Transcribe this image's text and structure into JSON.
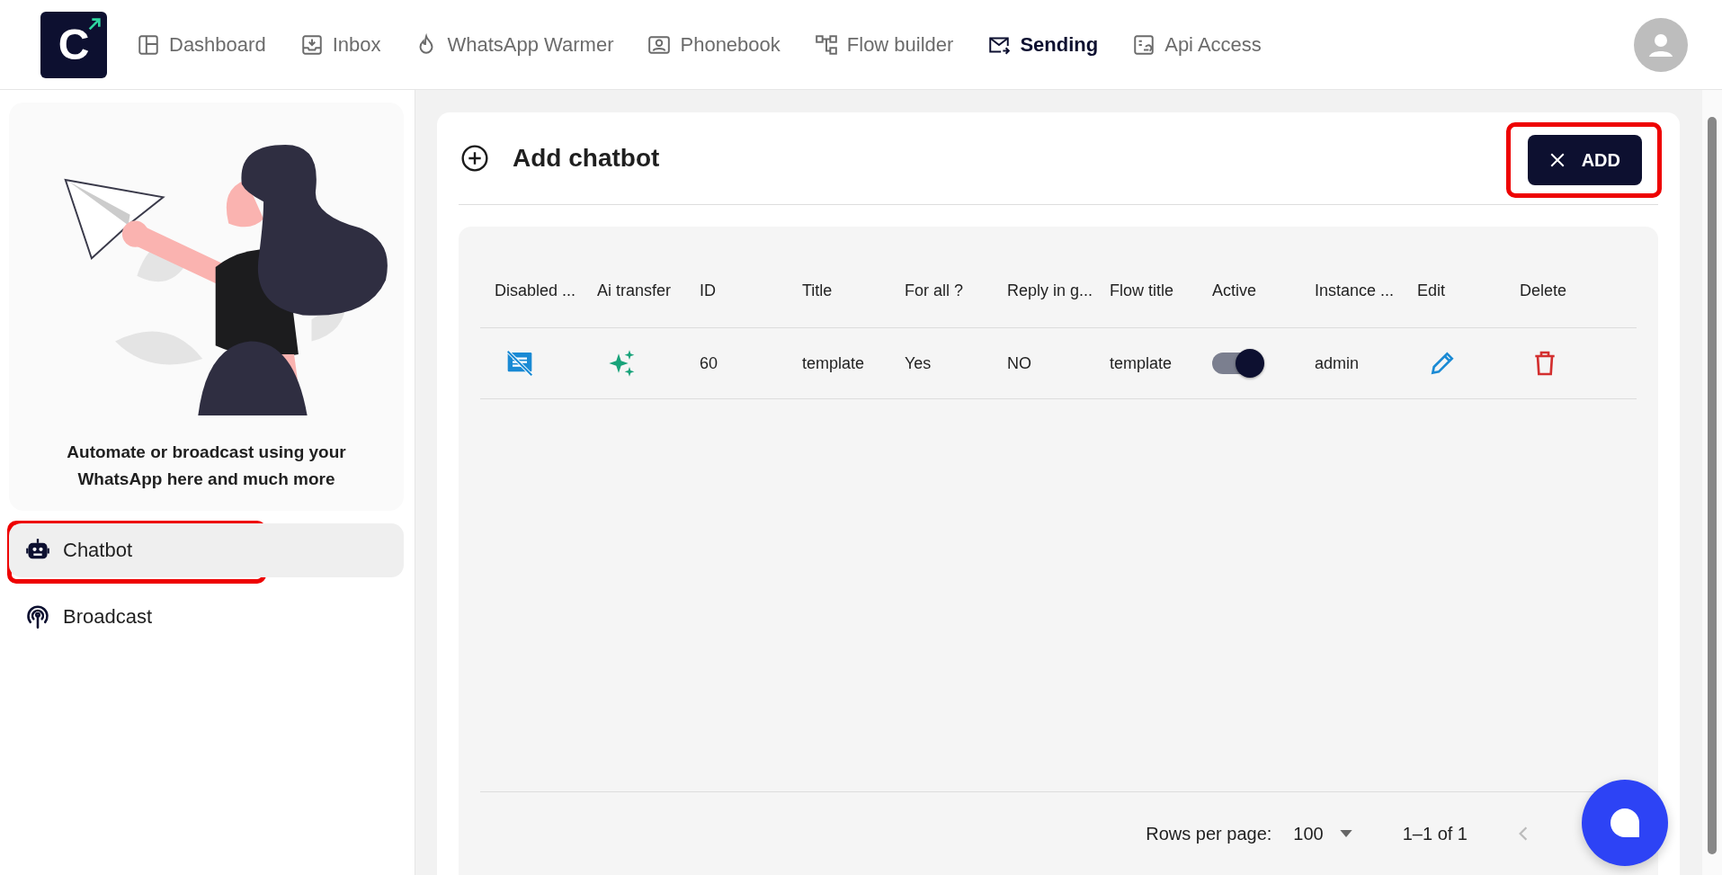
{
  "nav": {
    "logo": "C",
    "items": [
      {
        "label": "Dashboard",
        "kind": "dashboard",
        "selected": false
      },
      {
        "label": "Inbox",
        "kind": "inbox",
        "selected": false
      },
      {
        "label": "WhatsApp Warmer",
        "kind": "flame",
        "selected": false
      },
      {
        "label": "Phonebook",
        "kind": "contact",
        "selected": false
      },
      {
        "label": "Flow builder",
        "kind": "flow",
        "selected": false
      },
      {
        "label": "Sending",
        "kind": "mail",
        "selected": true
      },
      {
        "label": "Api Access",
        "kind": "api",
        "selected": false
      }
    ]
  },
  "sidebar": {
    "caption": "Automate or broadcast using your WhatsApp here and much more",
    "items": [
      {
        "label": "Chatbot",
        "kind": "robot",
        "selected": true,
        "highlighted": true
      },
      {
        "label": "Broadcast",
        "kind": "antenna",
        "selected": false,
        "highlighted": false
      }
    ]
  },
  "panel": {
    "title": "Add chatbot",
    "add_button": {
      "label": "ADD",
      "highlighted": true
    },
    "table": {
      "columns": [
        "Disabled ...",
        "Ai transfer",
        "ID",
        "Title",
        "For all ?",
        "Reply in g...",
        "Flow title",
        "Active",
        "Instance ...",
        "Edit",
        "Delete"
      ],
      "rows": [
        [
          {
            "kind": "disabled"
          },
          {
            "kind": "sparkle"
          },
          {
            "kind": "text",
            "text": "60"
          },
          {
            "kind": "text",
            "text": "template"
          },
          {
            "kind": "text",
            "text": "Yes"
          },
          {
            "kind": "text",
            "text": "NO"
          },
          {
            "kind": "text",
            "text": "template"
          },
          {
            "kind": "toggle",
            "on": true
          },
          {
            "kind": "text",
            "text": "admin"
          },
          {
            "kind": "edit"
          },
          {
            "kind": "delete"
          }
        ]
      ]
    },
    "footer": {
      "rows_label": "Rows per page:",
      "rows_value": "100",
      "range": "1–1 of 1"
    }
  }
}
